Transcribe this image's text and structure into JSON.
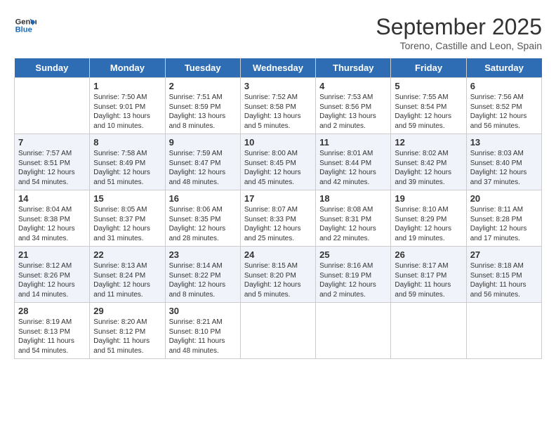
{
  "logo": {
    "line1": "General",
    "line2": "Blue"
  },
  "title": "September 2025",
  "location": "Toreno, Castille and Leon, Spain",
  "days_of_week": [
    "Sunday",
    "Monday",
    "Tuesday",
    "Wednesday",
    "Thursday",
    "Friday",
    "Saturday"
  ],
  "weeks": [
    [
      {
        "day": "",
        "info": ""
      },
      {
        "day": "1",
        "info": "Sunrise: 7:50 AM\nSunset: 9:01 PM\nDaylight: 13 hours\nand 10 minutes."
      },
      {
        "day": "2",
        "info": "Sunrise: 7:51 AM\nSunset: 8:59 PM\nDaylight: 13 hours\nand 8 minutes."
      },
      {
        "day": "3",
        "info": "Sunrise: 7:52 AM\nSunset: 8:58 PM\nDaylight: 13 hours\nand 5 minutes."
      },
      {
        "day": "4",
        "info": "Sunrise: 7:53 AM\nSunset: 8:56 PM\nDaylight: 13 hours\nand 2 minutes."
      },
      {
        "day": "5",
        "info": "Sunrise: 7:55 AM\nSunset: 8:54 PM\nDaylight: 12 hours\nand 59 minutes."
      },
      {
        "day": "6",
        "info": "Sunrise: 7:56 AM\nSunset: 8:52 PM\nDaylight: 12 hours\nand 56 minutes."
      }
    ],
    [
      {
        "day": "7",
        "info": "Sunrise: 7:57 AM\nSunset: 8:51 PM\nDaylight: 12 hours\nand 54 minutes."
      },
      {
        "day": "8",
        "info": "Sunrise: 7:58 AM\nSunset: 8:49 PM\nDaylight: 12 hours\nand 51 minutes."
      },
      {
        "day": "9",
        "info": "Sunrise: 7:59 AM\nSunset: 8:47 PM\nDaylight: 12 hours\nand 48 minutes."
      },
      {
        "day": "10",
        "info": "Sunrise: 8:00 AM\nSunset: 8:45 PM\nDaylight: 12 hours\nand 45 minutes."
      },
      {
        "day": "11",
        "info": "Sunrise: 8:01 AM\nSunset: 8:44 PM\nDaylight: 12 hours\nand 42 minutes."
      },
      {
        "day": "12",
        "info": "Sunrise: 8:02 AM\nSunset: 8:42 PM\nDaylight: 12 hours\nand 39 minutes."
      },
      {
        "day": "13",
        "info": "Sunrise: 8:03 AM\nSunset: 8:40 PM\nDaylight: 12 hours\nand 37 minutes."
      }
    ],
    [
      {
        "day": "14",
        "info": "Sunrise: 8:04 AM\nSunset: 8:38 PM\nDaylight: 12 hours\nand 34 minutes."
      },
      {
        "day": "15",
        "info": "Sunrise: 8:05 AM\nSunset: 8:37 PM\nDaylight: 12 hours\nand 31 minutes."
      },
      {
        "day": "16",
        "info": "Sunrise: 8:06 AM\nSunset: 8:35 PM\nDaylight: 12 hours\nand 28 minutes."
      },
      {
        "day": "17",
        "info": "Sunrise: 8:07 AM\nSunset: 8:33 PM\nDaylight: 12 hours\nand 25 minutes."
      },
      {
        "day": "18",
        "info": "Sunrise: 8:08 AM\nSunset: 8:31 PM\nDaylight: 12 hours\nand 22 minutes."
      },
      {
        "day": "19",
        "info": "Sunrise: 8:10 AM\nSunset: 8:29 PM\nDaylight: 12 hours\nand 19 minutes."
      },
      {
        "day": "20",
        "info": "Sunrise: 8:11 AM\nSunset: 8:28 PM\nDaylight: 12 hours\nand 17 minutes."
      }
    ],
    [
      {
        "day": "21",
        "info": "Sunrise: 8:12 AM\nSunset: 8:26 PM\nDaylight: 12 hours\nand 14 minutes."
      },
      {
        "day": "22",
        "info": "Sunrise: 8:13 AM\nSunset: 8:24 PM\nDaylight: 12 hours\nand 11 minutes."
      },
      {
        "day": "23",
        "info": "Sunrise: 8:14 AM\nSunset: 8:22 PM\nDaylight: 12 hours\nand 8 minutes."
      },
      {
        "day": "24",
        "info": "Sunrise: 8:15 AM\nSunset: 8:20 PM\nDaylight: 12 hours\nand 5 minutes."
      },
      {
        "day": "25",
        "info": "Sunrise: 8:16 AM\nSunset: 8:19 PM\nDaylight: 12 hours\nand 2 minutes."
      },
      {
        "day": "26",
        "info": "Sunrise: 8:17 AM\nSunset: 8:17 PM\nDaylight: 11 hours\nand 59 minutes."
      },
      {
        "day": "27",
        "info": "Sunrise: 8:18 AM\nSunset: 8:15 PM\nDaylight: 11 hours\nand 56 minutes."
      }
    ],
    [
      {
        "day": "28",
        "info": "Sunrise: 8:19 AM\nSunset: 8:13 PM\nDaylight: 11 hours\nand 54 minutes."
      },
      {
        "day": "29",
        "info": "Sunrise: 8:20 AM\nSunset: 8:12 PM\nDaylight: 11 hours\nand 51 minutes."
      },
      {
        "day": "30",
        "info": "Sunrise: 8:21 AM\nSunset: 8:10 PM\nDaylight: 11 hours\nand 48 minutes."
      },
      {
        "day": "",
        "info": ""
      },
      {
        "day": "",
        "info": ""
      },
      {
        "day": "",
        "info": ""
      },
      {
        "day": "",
        "info": ""
      }
    ]
  ]
}
